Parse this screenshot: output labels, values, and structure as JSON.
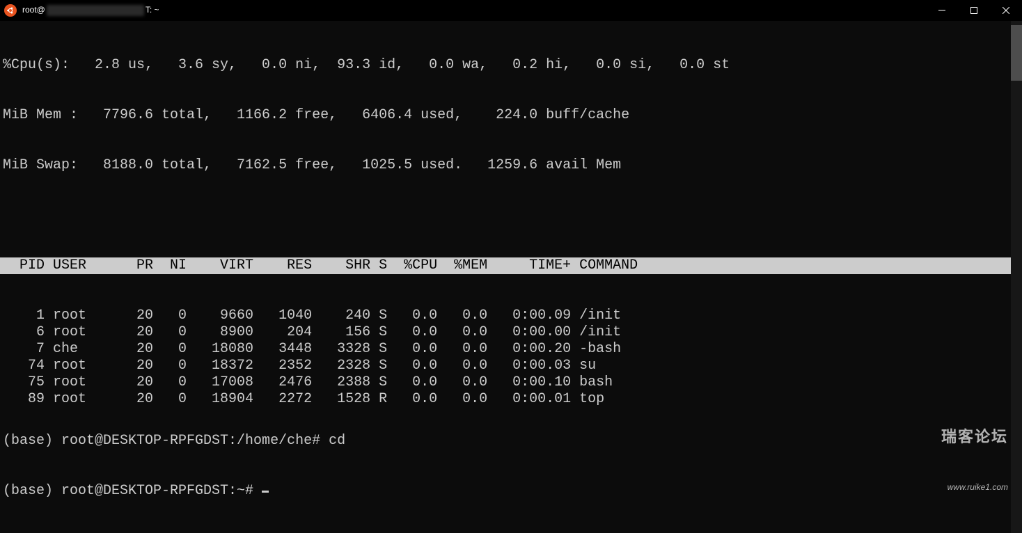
{
  "window": {
    "title_prefix": "root@",
    "title_suffix": "T: ~"
  },
  "cpu_line": "%Cpu(s):   2.8 us,   3.6 sy,   0.0 ni,  93.3 id,   0.0 wa,   0.2 hi,   0.0 si,   0.0 st",
  "mem_line": "MiB Mem :   7796.6 total,   1166.2 free,   6406.4 used,    224.0 buff/cache",
  "swap_line": "MiB Swap:   8188.0 total,   7162.5 free,   1025.5 used.   1259.6 avail Mem",
  "header": "  PID USER      PR  NI    VIRT    RES    SHR S  %CPU  %MEM     TIME+ COMMAND",
  "processes": [
    {
      "pid": "1",
      "user": "root",
      "pr": "20",
      "ni": "0",
      "virt": "9660",
      "res": "1040",
      "shr": "240",
      "s": "S",
      "cpu": "0.0",
      "mem": "0.0",
      "time": "0:00.09",
      "cmd": "/init"
    },
    {
      "pid": "6",
      "user": "root",
      "pr": "20",
      "ni": "0",
      "virt": "8900",
      "res": "204",
      "shr": "156",
      "s": "S",
      "cpu": "0.0",
      "mem": "0.0",
      "time": "0:00.00",
      "cmd": "/init"
    },
    {
      "pid": "7",
      "user": "che",
      "pr": "20",
      "ni": "0",
      "virt": "18080",
      "res": "3448",
      "shr": "3328",
      "s": "S",
      "cpu": "0.0",
      "mem": "0.0",
      "time": "0:00.20",
      "cmd": "-bash"
    },
    {
      "pid": "74",
      "user": "root",
      "pr": "20",
      "ni": "0",
      "virt": "18372",
      "res": "2352",
      "shr": "2328",
      "s": "S",
      "cpu": "0.0",
      "mem": "0.0",
      "time": "0:00.03",
      "cmd": "su"
    },
    {
      "pid": "75",
      "user": "root",
      "pr": "20",
      "ni": "0",
      "virt": "17008",
      "res": "2476",
      "shr": "2388",
      "s": "S",
      "cpu": "0.0",
      "mem": "0.0",
      "time": "0:00.10",
      "cmd": "bash"
    },
    {
      "pid": "89",
      "user": "root",
      "pr": "20",
      "ni": "0",
      "virt": "18904",
      "res": "2272",
      "shr": "1528",
      "s": "R",
      "cpu": "0.0",
      "mem": "0.0",
      "time": "0:00.01",
      "cmd": "top"
    }
  ],
  "prompts": {
    "line1": "(base) root@DESKTOP-RPFGDST:/home/che# cd",
    "line2": "(base) root@DESKTOP-RPFGDST:~# "
  },
  "watermark": {
    "line1": "瑞客论坛",
    "line2": "www.ruike1.com"
  }
}
